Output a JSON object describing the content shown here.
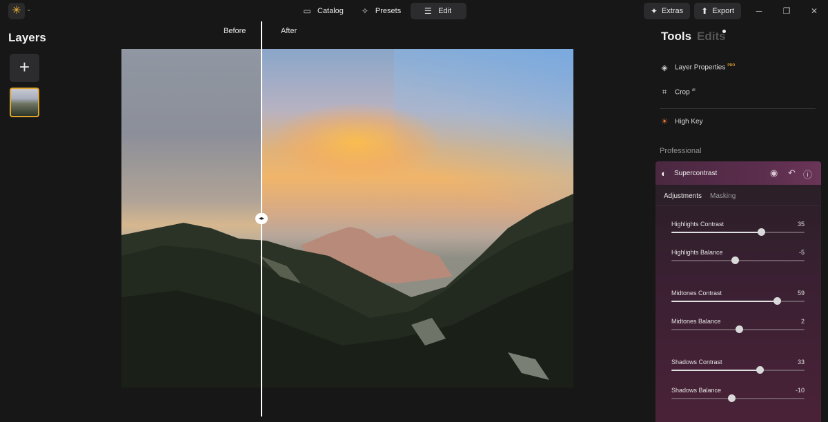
{
  "app": {
    "logo_icon": "sun-logo-icon",
    "accent": "#e0a42c"
  },
  "nav": {
    "catalog": "Catalog",
    "presets": "Presets",
    "edit": "Edit"
  },
  "top_right": {
    "extras": "Extras",
    "export": "Export"
  },
  "layers": {
    "title": "Layers"
  },
  "compare": {
    "before": "Before",
    "after": "After",
    "split_fraction": 0.31
  },
  "tabs": {
    "tools": "Tools",
    "edits": "Edits"
  },
  "tools": {
    "layer_properties": "Layer Properties",
    "layer_properties_badge": "PRO",
    "crop": "Crop",
    "crop_badge": "AI",
    "high_key": "High Key"
  },
  "professional": {
    "section": "Professional",
    "tool_title": "Supercontrast",
    "subtabs": {
      "adjustments": "Adjustments",
      "masking": "Masking"
    },
    "sliders": [
      {
        "label": "Highlights Contrast",
        "value": "35",
        "min": -100,
        "max": 100,
        "num": 35,
        "bipolar": false
      },
      {
        "label": "Highlights Balance",
        "value": "-5",
        "min": -100,
        "max": 100,
        "num": -5,
        "bipolar": true
      },
      {
        "label": "Midtones Contrast",
        "value": "59",
        "min": -100,
        "max": 100,
        "num": 59,
        "bipolar": false
      },
      {
        "label": "Midtones Balance",
        "value": "2",
        "min": -100,
        "max": 100,
        "num": 2,
        "bipolar": true
      },
      {
        "label": "Shadows Contrast",
        "value": "33",
        "min": -100,
        "max": 100,
        "num": 33,
        "bipolar": false
      },
      {
        "label": "Shadows Balance",
        "value": "-10",
        "min": -100,
        "max": 100,
        "num": -10,
        "bipolar": true
      }
    ]
  }
}
